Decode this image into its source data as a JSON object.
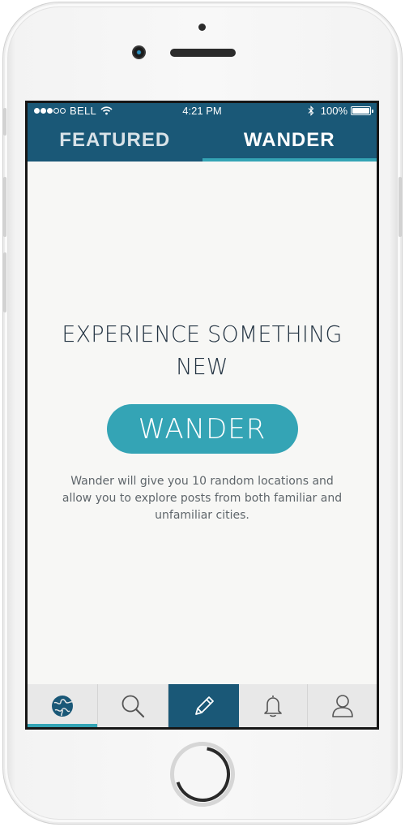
{
  "status_bar": {
    "carrier": "BELL",
    "time": "4:21 PM",
    "battery": "100%"
  },
  "top_tabs": [
    {
      "label": "FEATURED",
      "active": false
    },
    {
      "label": "WANDER",
      "active": true
    }
  ],
  "wander": {
    "headline_line1": "EXPERIENCE SOMETHING",
    "headline_line2": "NEW",
    "button_label": "WANDER",
    "description": "Wander will give you 10 random locations and allow you to explore posts from both familiar and unfamiliar cities."
  },
  "bottom_nav": [
    {
      "icon": "globe-icon",
      "active": true
    },
    {
      "icon": "search-icon",
      "active": false
    },
    {
      "icon": "pencil-icon",
      "active": false,
      "highlighted": true
    },
    {
      "icon": "bell-icon",
      "active": false
    },
    {
      "icon": "user-icon",
      "active": false
    }
  ],
  "colors": {
    "header": "#1a5877",
    "accent": "#34a4b5",
    "background": "#f7f7f5",
    "text_dark": "#243443",
    "text_body": "#5f666b",
    "nav_bg": "#e8e8e8"
  }
}
